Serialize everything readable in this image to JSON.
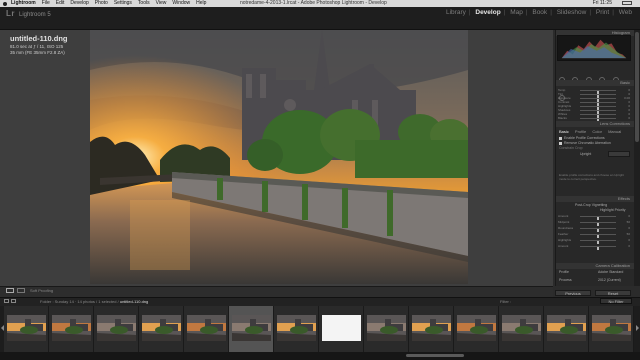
{
  "menubar": {
    "app": "Lightroom",
    "items": [
      "File",
      "Edit",
      "Develop",
      "Photo",
      "Settings",
      "Tools",
      "View",
      "Window",
      "Help"
    ],
    "doc_title": "notredame-4-2013-1.lrcat - Adobe Photoshop Lightroom - Develop",
    "clock": "Fri 11:25"
  },
  "header": {
    "logo": "Lr",
    "product": "Lightroom 5",
    "modules": [
      "Library",
      "Develop",
      "Map",
      "Book",
      "Slideshow",
      "Print",
      "Web"
    ],
    "active_module": "Develop"
  },
  "image_info": {
    "filename": "untitled-110.dng",
    "exposure": "81.0 sec at ƒ / 11, ISO 125",
    "lens": "35 mm (FE 35mm F2.8 ZA)"
  },
  "right_panel": {
    "histogram_label": "Histogram",
    "basic_label": "Basic",
    "lens_label": "Lens Corrections",
    "lens_tabs": [
      "Basic",
      "Profile",
      "Color",
      "Manual"
    ],
    "lens_active_tab": "Basic",
    "checks": [
      "Enable Profile Corrections",
      "Remove Chromatic Aberration"
    ],
    "constrain_label": "Constrain Crop",
    "upright_label": "Upright",
    "upright_note": "Enable profile corrections and choose an Upright mode to correct perspective.",
    "effects_label": "Effects",
    "vignette_label": "Post-Crop Vignetting",
    "vignette_style": "Highlight Priority",
    "calibration_label": "Camera Calibration",
    "profile_label": "Profile",
    "profile_value": "Adobe Standard",
    "process_label": "Process",
    "process_value": "2012 (Current)",
    "previous_button": "Previous",
    "reset_button": "Reset",
    "sliders": [
      {
        "label": "Temp",
        "value": "0"
      },
      {
        "label": "Tint",
        "value": "0"
      },
      {
        "label": "Exposure",
        "value": "0.00"
      },
      {
        "label": "Contrast",
        "value": "0"
      },
      {
        "label": "Highlights",
        "value": "0"
      },
      {
        "label": "Shadows",
        "value": "0"
      },
      {
        "label": "Whites",
        "value": "0"
      },
      {
        "label": "Blacks",
        "value": "0"
      }
    ],
    "effect_sliders": [
      {
        "label": "Amount",
        "value": "0"
      },
      {
        "label": "Midpoint",
        "value": "50"
      },
      {
        "label": "Roundness",
        "value": "0"
      },
      {
        "label": "Feather",
        "value": "50"
      },
      {
        "label": "Highlights",
        "value": "0"
      },
      {
        "label": "Amount",
        "value": "0"
      }
    ]
  },
  "toolbar": {
    "soft_proofing": "Soft Proofing"
  },
  "filmstrip_bar": {
    "path_prefix": "Folder : Sunday 14 · 14 photos / 1 selected /",
    "selected_file": "untitled-110.dng",
    "filter_label": "Filter :",
    "filter_value": "No Filter"
  },
  "filmstrip": {
    "count": 14,
    "selected_index": 5,
    "blank_index": 7
  }
}
